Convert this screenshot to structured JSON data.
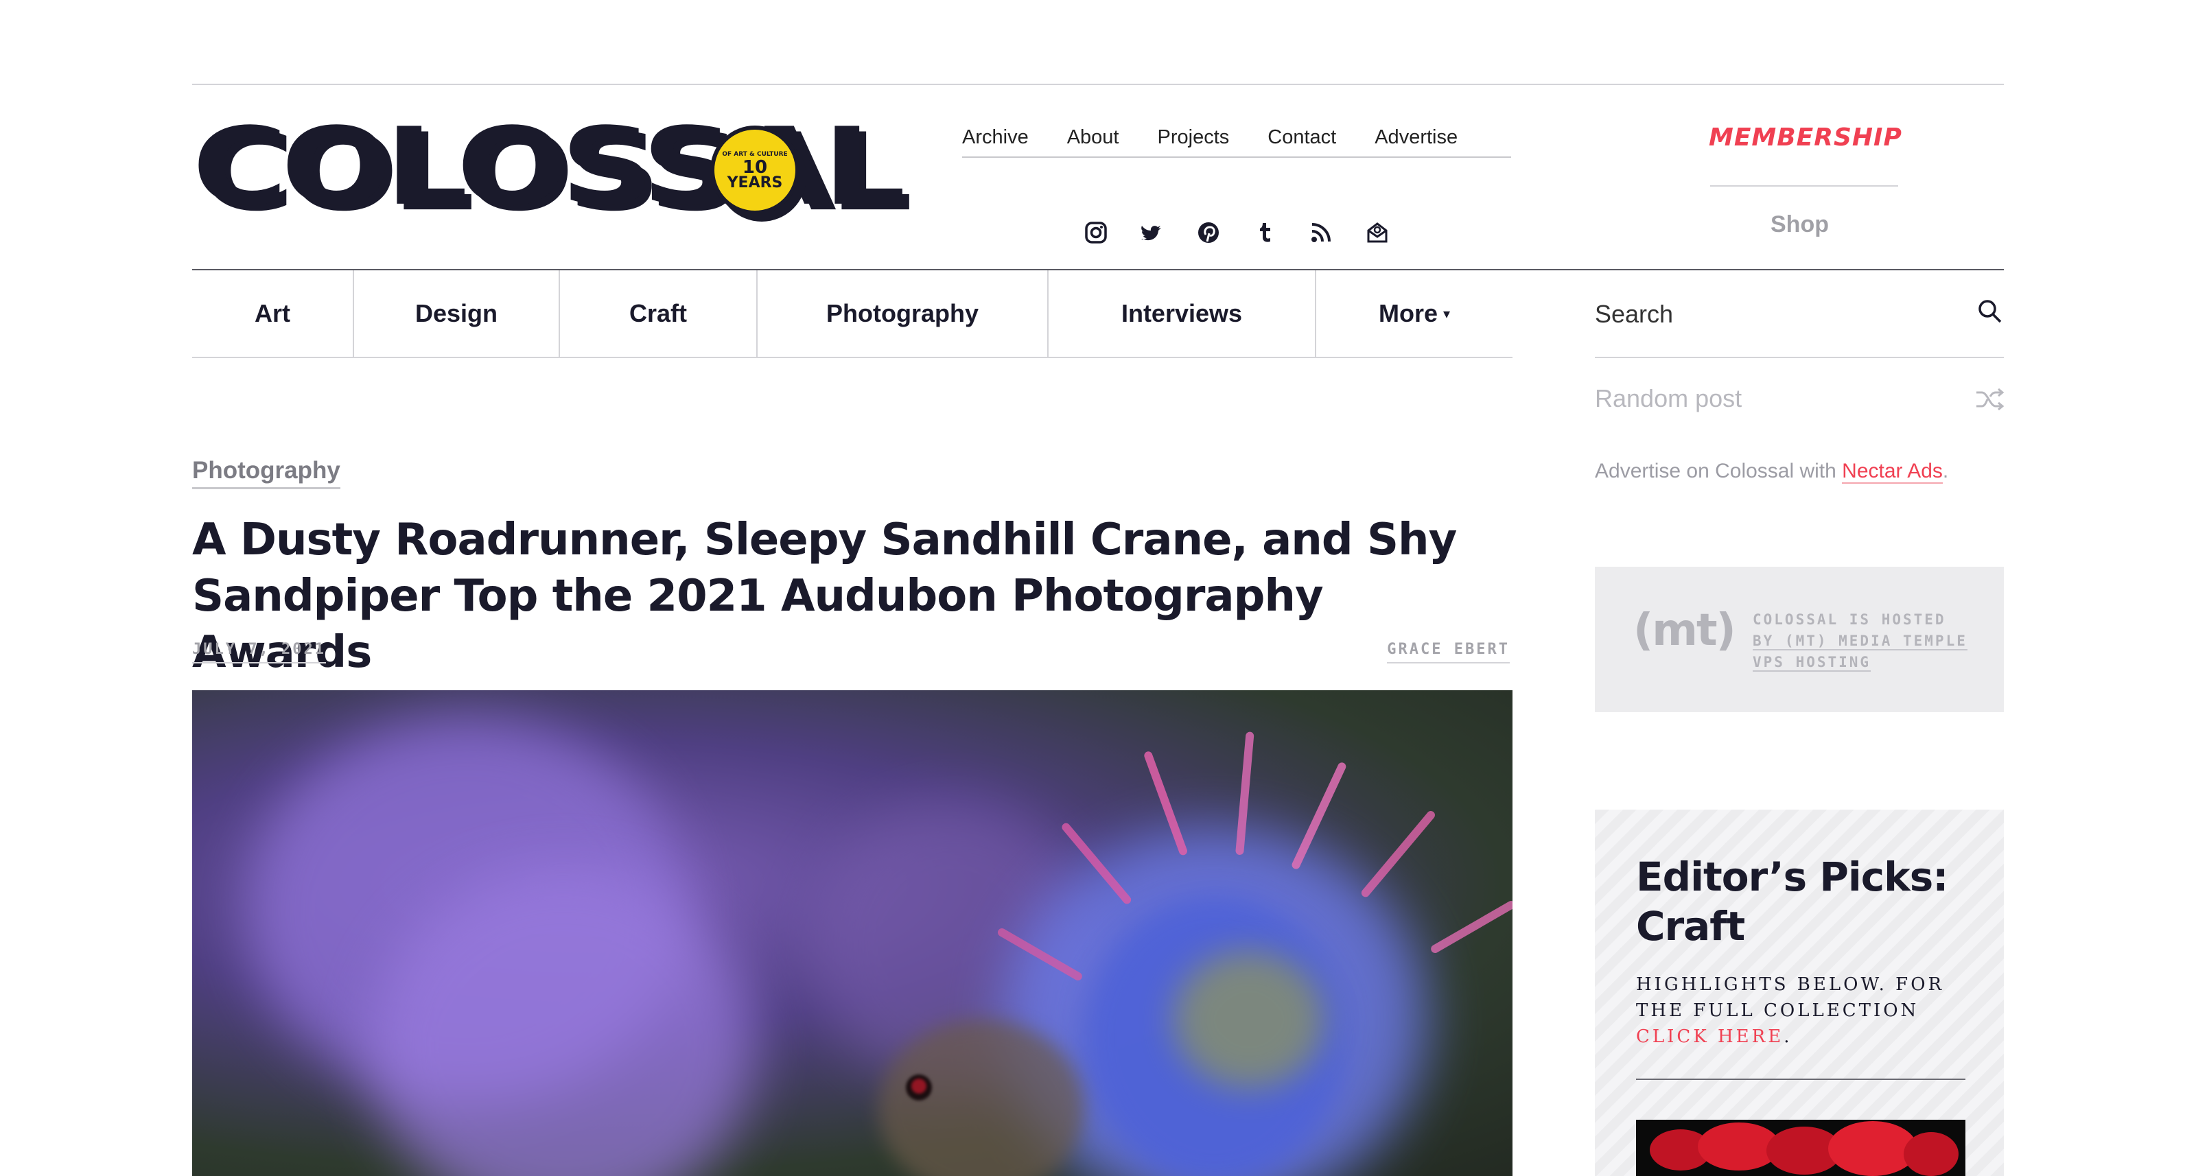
{
  "logo": {
    "wordmark": "COLOSSAL",
    "badge_line1": "10",
    "badge_line2": "YEARS",
    "badge_ring": "OF ART & CULTURE"
  },
  "top_nav": [
    "Archive",
    "About",
    "Projects",
    "Contact",
    "Advertise"
  ],
  "social_icons": [
    "instagram-icon",
    "twitter-icon",
    "pinterest-icon",
    "tumblr-icon",
    "rss-icon",
    "newsletter-icon"
  ],
  "membership": {
    "label": "MEMBERSHIP",
    "shop": "Shop"
  },
  "categories": [
    "Art",
    "Design",
    "Craft",
    "Photography",
    "Interviews",
    "More"
  ],
  "search": {
    "placeholder": "Search"
  },
  "random_post": "Random post",
  "advertise": {
    "prefix": "Advertise on Colossal with ",
    "link": "Nectar Ads",
    "suffix": "."
  },
  "hosting": {
    "logo": "(mt)",
    "line1": "COLOSSAL IS HOSTED",
    "line2": "BY (MT) MEDIA TEMPLE",
    "line3": "VPS HOSTING"
  },
  "editors_picks": {
    "title": "Editor’s Picks: Craft",
    "subtitle": "HIGHLIGHTS BELOW. FOR THE FULL COLLECTION ",
    "link": "CLICK HERE",
    "suffix": "."
  },
  "article": {
    "category": "Photography",
    "title": "A Dusty Roadrunner, Sleepy Sandhill Crane, and Shy Sandpiper Top the 2021 Audubon Photography Awards",
    "date": "JULY 7, 2021",
    "author": "GRACE EBERT"
  },
  "colors": {
    "accent": "#f04052",
    "text": "#1a1a2b",
    "muted": "#a4a4aa"
  }
}
